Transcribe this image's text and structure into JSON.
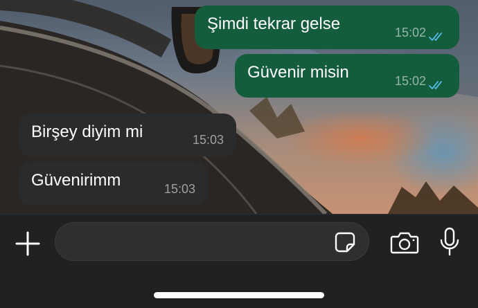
{
  "messages": [
    {
      "text": "Şimdi tekrar gelse",
      "time": "15:02",
      "direction": "outgoing",
      "status": "read"
    },
    {
      "text": "Güvenir misin",
      "time": "15:02",
      "direction": "outgoing",
      "status": "read"
    },
    {
      "text": "Birşey diyim mi",
      "time": "15:03",
      "direction": "incoming"
    },
    {
      "text": "Güvenirimm",
      "time": "15:03",
      "direction": "incoming"
    }
  ],
  "composer": {
    "value": "",
    "placeholder": ""
  },
  "icons": {
    "attach": "plus-icon",
    "sticker": "sticker-icon",
    "camera": "camera-icon",
    "voice": "microphone-icon",
    "read_receipt": "double-check-icon"
  },
  "colors": {
    "outgoing_bubble": "#135c3c",
    "incoming_bubble": "#2a2b2d",
    "read_tick": "#53bdeb",
    "bar_background": "#1f2123"
  }
}
